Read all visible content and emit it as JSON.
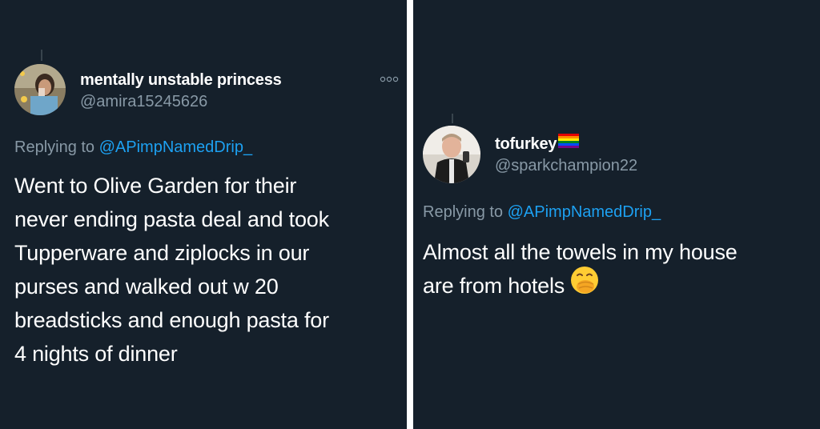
{
  "tweets": [
    {
      "display_name": "mentally unstable princess",
      "handle": "@amira15245626",
      "more_icon": "more-options-icon",
      "replying_prefix": "Replying to",
      "replying_to": "@APimpNamedDrip_",
      "text_lines": [
        "Went to Olive Garden for their",
        "never ending pasta deal and took",
        "Tupperware and ziplocks in our",
        "purses and walked out w 20",
        "breadsticks and enough pasta for",
        "4 nights of dinner"
      ]
    },
    {
      "display_name": "tofurkey",
      "name_badge": "rainbow-flag-icon",
      "handle": "@sparkchampion22",
      "replying_prefix": "Replying to",
      "replying_to": "@APimpNamedDrip_",
      "text_lines": [
        "Almost all the towels in my house",
        "are from hotels"
      ],
      "emoji": "face-with-hand-over-mouth-icon"
    }
  ],
  "colors": {
    "background": "#15202b",
    "divider": "#ffffff",
    "primary_text": "#ffffff",
    "secondary_text": "#8899a6",
    "link": "#1da1f2"
  }
}
